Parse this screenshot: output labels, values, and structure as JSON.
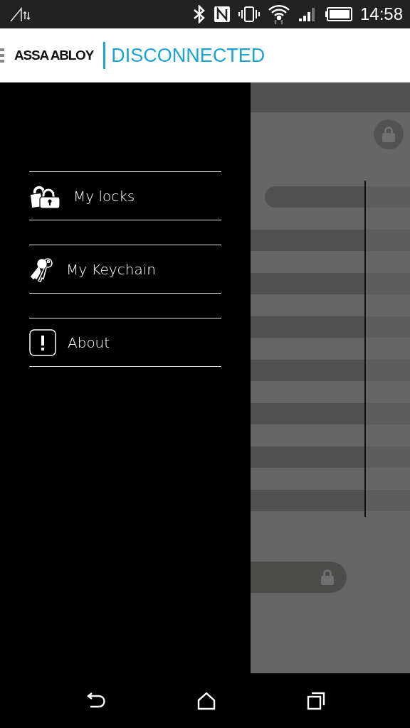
{
  "status_bar": {
    "time": "14:58"
  },
  "app_bar": {
    "brand": "ASSA ABLOY",
    "connection_status": "DISCONNECTED"
  },
  "drawer": {
    "items": [
      {
        "kind": "locks",
        "label": "My locks"
      },
      {
        "kind": "keychain",
        "label": "My Keychain"
      },
      {
        "kind": "about",
        "label": "About"
      }
    ]
  }
}
